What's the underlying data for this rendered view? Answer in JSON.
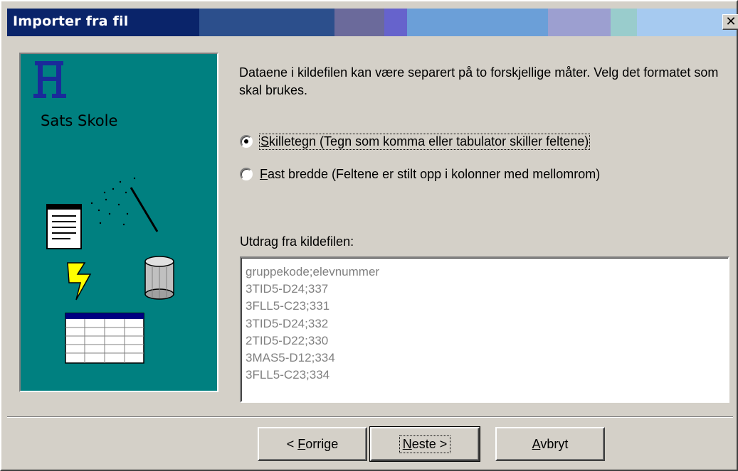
{
  "window": {
    "title": "Importer fra fil",
    "close_glyph": "✕"
  },
  "side_panel": {
    "logo_text": "Sats Skole",
    "logo_icon": "school-logo-icon",
    "illustration": [
      "notepad-icon",
      "magic-wand-icon",
      "lightning-icon",
      "database-icon",
      "table-icon"
    ],
    "background_color": "#008080"
  },
  "instructions": "Dataene i kildefilen kan være separert på to forskjellige måter. Velg det formatet som skal brukes.",
  "options": [
    {
      "accel": "S",
      "rest": "killetegn (Tegn som komma eller tabulator skiller feltene)",
      "selected": true
    },
    {
      "accel": "F",
      "rest": "ast bredde (Feltene er stilt opp i kolonner med mellomrom)",
      "selected": false
    }
  ],
  "excerpt": {
    "label": "Utdrag fra kildefilen:",
    "lines": [
      "gruppekode;elevnummer",
      "3TID5-D24;337",
      "3FLL5-C23;331",
      "3TID5-D24;332",
      "2TID5-D22;330",
      "3MAS5-D12;334",
      "3FLL5-C23;334"
    ]
  },
  "buttons": {
    "back": {
      "prefix": "< ",
      "accel": "F",
      "rest": "orrige"
    },
    "next": {
      "accel": "N",
      "rest": "este >"
    },
    "cancel": {
      "accel": "A",
      "rest": "vbryt"
    }
  }
}
